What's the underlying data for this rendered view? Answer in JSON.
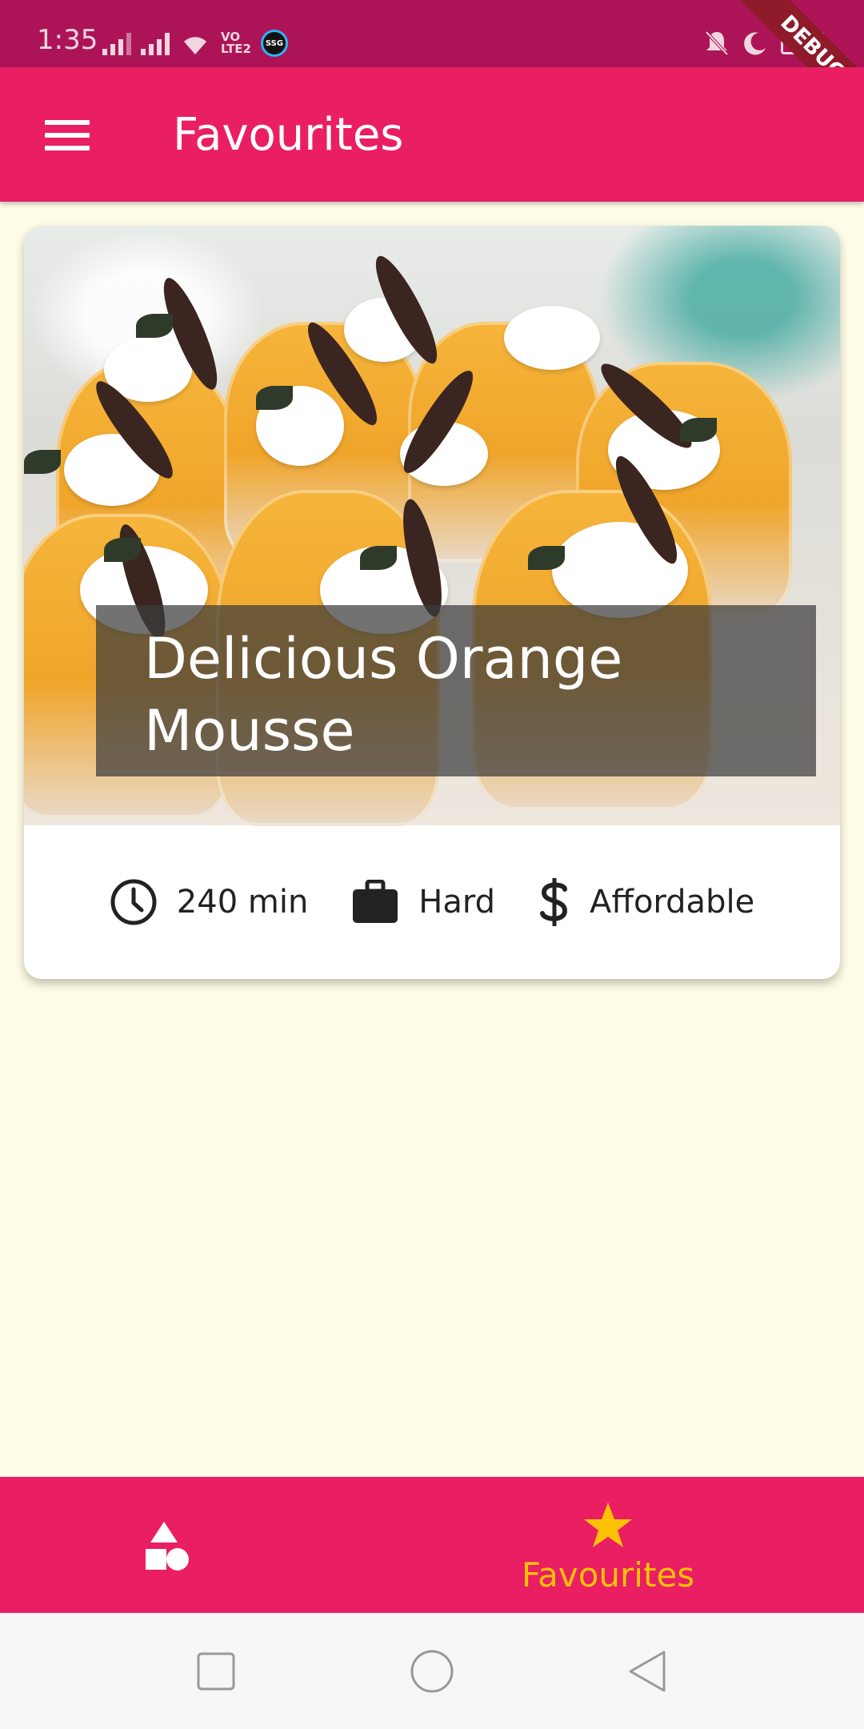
{
  "status_bar": {
    "time": "1:35",
    "volte_line1": "VO",
    "volte_line2": "LTE2",
    "badge": "SSG"
  },
  "debug_banner": "DEBUG",
  "app_bar": {
    "title": "Favourites",
    "menu_icon": "menu-icon"
  },
  "meal": {
    "title": "Delicious Orange Mousse",
    "duration": "240 min",
    "complexity": "Hard",
    "affordability": "Affordable"
  },
  "bottom_nav": {
    "items": [
      {
        "label": "",
        "icon": "category-icon",
        "selected": false
      },
      {
        "label": "Favourites",
        "icon": "star-icon",
        "selected": true
      }
    ],
    "selected_color": "#ffc107"
  },
  "colors": {
    "primary": "#e91e63",
    "status_bar": "#ad1457",
    "background": "#fffde7",
    "accent": "#ffc107"
  }
}
